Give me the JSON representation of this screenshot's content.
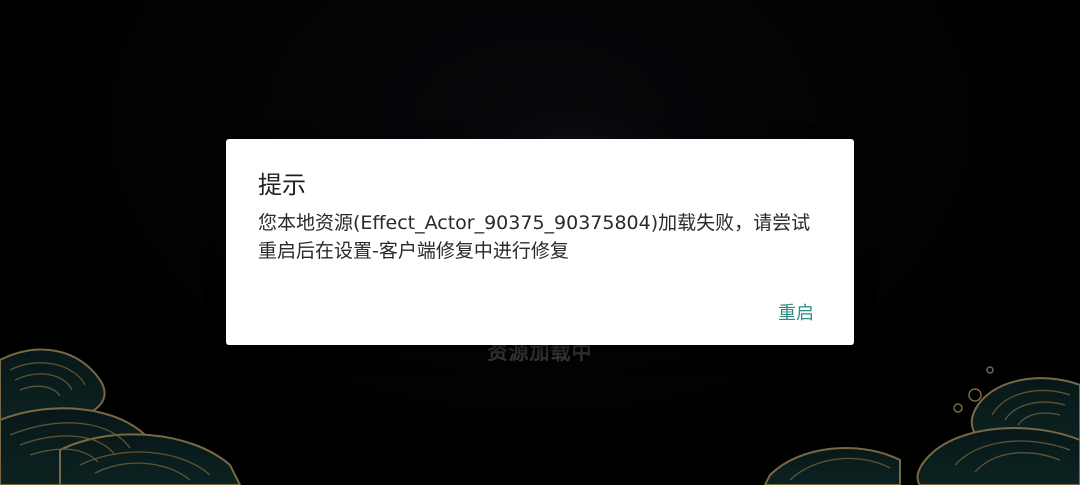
{
  "background": {
    "loading_text": "资源加载中"
  },
  "dialog": {
    "title": "提示",
    "message": "您本地资源(Effect_Actor_90375_90375804)加载失败，请尝试重启后在设置-客户端修复中进行修复",
    "button_label": "重启"
  },
  "colors": {
    "accent": "#2f8c84",
    "wave_gold": "#b8a06a",
    "wave_teal": "#1f4a48"
  }
}
